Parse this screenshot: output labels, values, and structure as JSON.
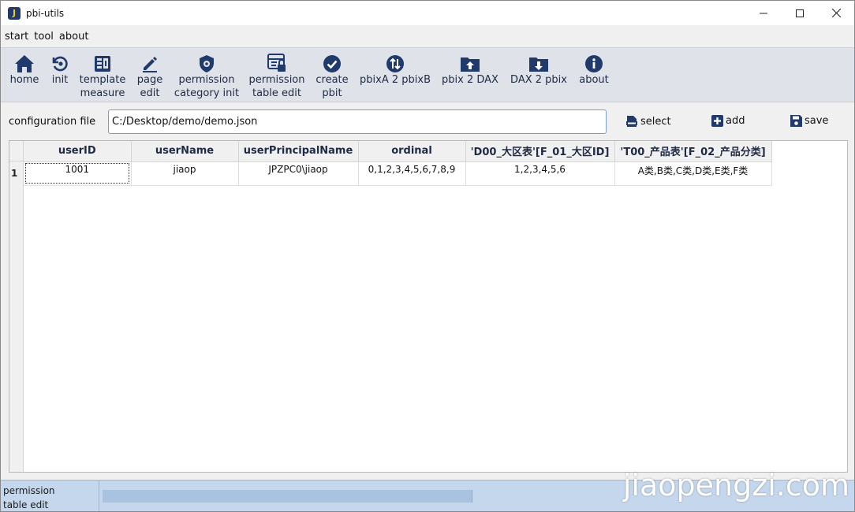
{
  "window": {
    "title": "pbi-utils",
    "app_icon_letter": "J"
  },
  "window_controls": {
    "minimize": "–",
    "maximize": "☐",
    "close": "✕"
  },
  "menu": {
    "items": [
      "start",
      "tool",
      "about"
    ]
  },
  "toolbar": {
    "items": [
      {
        "label_lines": [
          "home"
        ],
        "icon": "home-icon"
      },
      {
        "label_lines": [
          "init"
        ],
        "icon": "refresh-icon"
      },
      {
        "label_lines": [
          "template",
          "measure"
        ],
        "icon": "template-icon"
      },
      {
        "label_lines": [
          "page",
          "edit"
        ],
        "icon": "pencil-icon"
      },
      {
        "label_lines": [
          "permission",
          "category init"
        ],
        "icon": "shield-gear-icon"
      },
      {
        "label_lines": [
          "permission",
          "table edit"
        ],
        "icon": "table-lock-icon"
      },
      {
        "label_lines": [
          "create",
          "pbit"
        ],
        "icon": "check-circle-icon"
      },
      {
        "label_lines": [
          "pbixA 2 pbixB"
        ],
        "icon": "swap-circle-icon"
      },
      {
        "label_lines": [
          "pbix 2 DAX"
        ],
        "icon": "folder-upload-icon"
      },
      {
        "label_lines": [
          "DAX 2 pbix"
        ],
        "icon": "folder-download-icon"
      },
      {
        "label_lines": [
          "about"
        ],
        "icon": "info-icon"
      }
    ],
    "icon_color": "#1f3a6b"
  },
  "config": {
    "label": "configuration file",
    "path_value": "C:/Desktop/demo/demo.json",
    "select_label": "select",
    "add_label": "add",
    "save_label": "save"
  },
  "table": {
    "columns": [
      "userID",
      "userName",
      "userPrincipalName",
      "ordinal",
      "'D00_大区表'[F_01_大区ID]",
      "'T00_产品表'[F_02_产品分类]"
    ],
    "rows": [
      {
        "row_number": "1",
        "cells": [
          "1001",
          "jiaop",
          "JPZPC0\\jiaop",
          "0,1,2,3,4,5,6,7,8,9",
          "1,2,3,4,5,6",
          "A类,B类,C类,D类,E类,F类"
        ]
      }
    ]
  },
  "status": {
    "text_lines": [
      "permission",
      "table edit"
    ],
    "progress_fraction": 1.0
  },
  "watermark": "jiaopengzi.com"
}
